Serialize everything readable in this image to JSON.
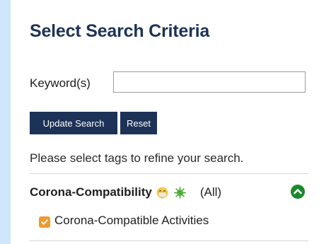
{
  "heading": "Select Search Criteria",
  "keyword": {
    "label": "Keyword(s)",
    "value": "",
    "placeholder": ""
  },
  "buttons": {
    "update": "Update Search",
    "reset": "Reset"
  },
  "hint": "Please select tags to refine your search.",
  "tag_group": {
    "title": "Corona-Compatibility",
    "icons": [
      "face-with-mask-icon",
      "virus-icon"
    ],
    "all_label": "(All)",
    "expanded": true,
    "options": [
      {
        "label": "Corona-Compatible Activities",
        "checked": true
      }
    ]
  },
  "colors": {
    "background": "#cfe6fb",
    "primary": "#1d3257",
    "checkbox": "#ef9a2f",
    "collapse_icon": "#1b8a2e"
  }
}
